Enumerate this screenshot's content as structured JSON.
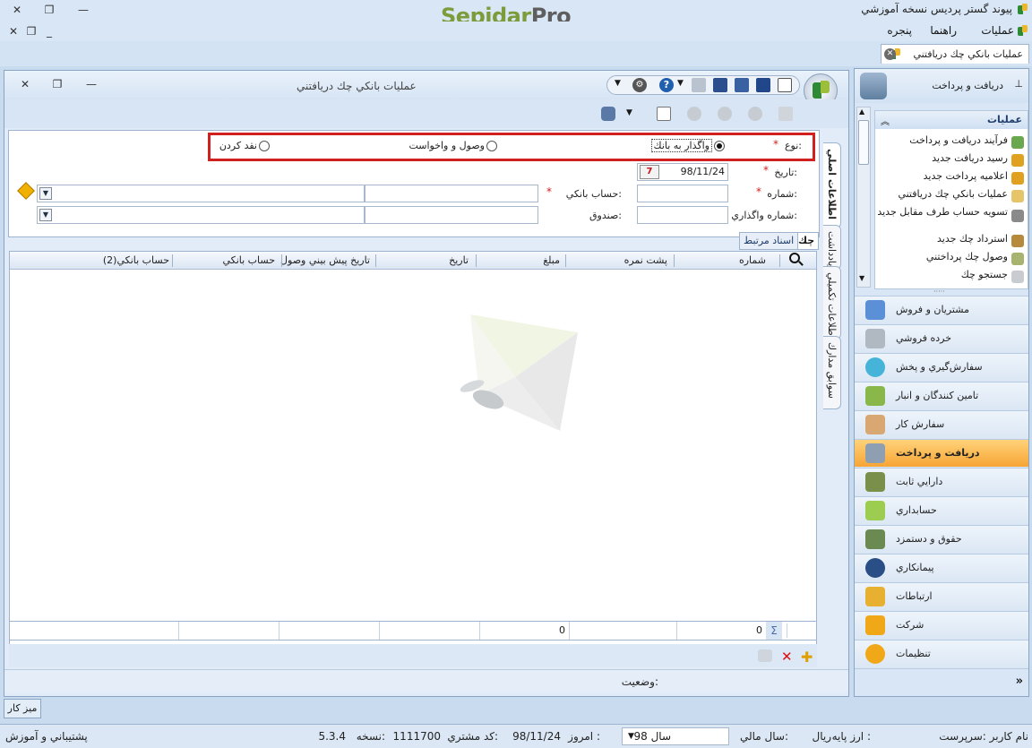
{
  "app": {
    "title": "پيوند گستر پرديس نسخه آموزشي",
    "brand_part1": "Sepidar",
    "brand_part2": "Pro"
  },
  "menubar": {
    "operations": "عمليات",
    "help": "راهنما",
    "window": "پنجره"
  },
  "doc_tab": {
    "label": "عمليات بانكي چك دريافتني"
  },
  "window": {
    "title": "عمليات بانكي چك دريافتني"
  },
  "form": {
    "type_label": "نوع:",
    "type_options": [
      "واگذار به بانك",
      "وصول و واخواست",
      "نقد كردن"
    ],
    "type_selected": "واگذار به بانك",
    "date_label": "تاريخ:",
    "date_value": "98/11/24",
    "number_label": "شماره:",
    "bank_account_label": "حساب بانكي:",
    "assign_number_label": "شماره واگذاري:",
    "fund_label": "صندوق:",
    "required_mark": "*"
  },
  "side_tabs": [
    "اطلاعات اصلي",
    "يادداشت",
    "اطلاعات تكميلي",
    "سوابق مدارك"
  ],
  "grid": {
    "tab_checks": "چك",
    "tab_related_docs": "اسناد مرتبط",
    "columns": [
      "شماره",
      "پشت نمره",
      "مبلغ",
      "تاريخ",
      "تاريخ پيش بيني وصول",
      "حساب بانكي",
      "حساب بانكي(2)"
    ],
    "footer_count": "0",
    "footer_amount": "0",
    "sigma": "Σ"
  },
  "status": {
    "label": "وضعيت:"
  },
  "right_panel": {
    "header": "دريافت و پرداخت",
    "ops_title": "عمليات",
    "ops_items": [
      "فرآيند دريافت و پرداخت",
      "رسيد دريافت جديد",
      "اعلاميه پرداخت جديد",
      "عمليات بانكي چك دريافتني",
      "تسويه حساب طرف مقابل جديد",
      "استرداد چك جديد",
      "وصول چك پرداختني",
      "جستجو چك"
    ],
    "modules": [
      "مشتريان و فروش",
      "خرده فروشي",
      "سفارش‌گيري و پخش",
      "تامين كنندگان و انبار",
      "سفارش كار",
      "دريافت و پرداخت",
      "دارايي ثابت",
      "حسابداري",
      "حقوق و دستمزد",
      "پيمانكاري",
      "ارتباطات",
      "شركت",
      "تنظيمات"
    ],
    "active_module": "دريافت و پرداخت",
    "expand": "»"
  },
  "desk_button": "ميز كار",
  "statusbar": {
    "user": "نام كاربر :سرپرست",
    "base_currency_label": "ارز پايه :",
    "base_currency": "ريال",
    "fiscal_year_label": "سال مالي:",
    "fiscal_year": "سال 98",
    "today_label": "امروز :",
    "today": "98/11/24",
    "customer_code_label": "كد مشتري:",
    "customer_code": "1111700",
    "version_label": "نسخه:",
    "version": "5.3.4",
    "support": "پشتيباني و آموزش"
  },
  "colors": {
    "accent_red": "#d0201f",
    "active_module": "#f7a534",
    "brand_green": "#7c9b3a"
  }
}
